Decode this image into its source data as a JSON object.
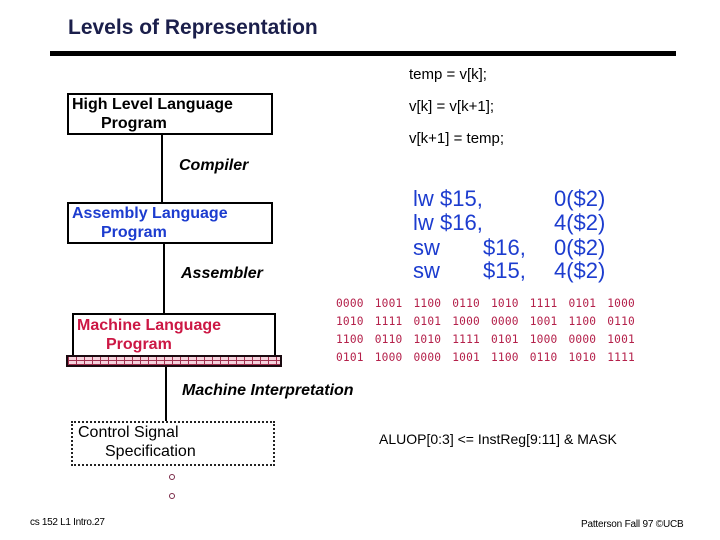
{
  "title": "Levels of Representation",
  "levels": {
    "high_level": {
      "line1": "High Level Language",
      "line2": "Program"
    },
    "assembly": {
      "line1": "Assembly  Language",
      "line2": "Program"
    },
    "machine": {
      "line1": "Machine  Language",
      "line2": "Program"
    },
    "control": {
      "line1": "Control Signal",
      "line2": "Specification"
    }
  },
  "stages": {
    "compiler": "Compiler",
    "assembler": "Assembler",
    "interpretation": "Machine Interpretation"
  },
  "high_level_code": [
    "temp = v[k];",
    "v[k] = v[k+1];",
    "v[k+1] = temp;"
  ],
  "assembly_code": [
    {
      "op": "lw",
      "reg": "$15,",
      "addr": "0($2)"
    },
    {
      "op": "lw",
      "reg": "$16,",
      "addr": "4($2)"
    },
    {
      "op": "sw",
      "reg": "$16,",
      "addr": "0($2)"
    },
    {
      "op": "sw",
      "reg": "$15,",
      "addr": "4($2)"
    }
  ],
  "machine_code": [
    [
      "0000",
      "1001",
      "1100",
      "0110",
      "1010",
      "1111",
      "0101",
      "1000"
    ],
    [
      "1010",
      "1111",
      "0101",
      "1000",
      "0000",
      "1001",
      "1100",
      "0110"
    ],
    [
      "1100",
      "0110",
      "1010",
      "1111",
      "0101",
      "1000",
      "0000",
      "1001"
    ],
    [
      "0101",
      "1000",
      "0000",
      "1001",
      "1100",
      "0110",
      "1010",
      "1111"
    ]
  ],
  "control_rtl": "ALUOP[0:3] <= InstReg[9:11] & MASK",
  "continuation": "°  °",
  "footer": {
    "left": "cs 152  L1 Intro.27",
    "right": "Patterson Fall 97 ©UCB"
  },
  "colors": {
    "title": "#1b1f4b",
    "assembly": "#1c3ccf",
    "machine": "#cc1744",
    "binary": "#b4204a"
  }
}
